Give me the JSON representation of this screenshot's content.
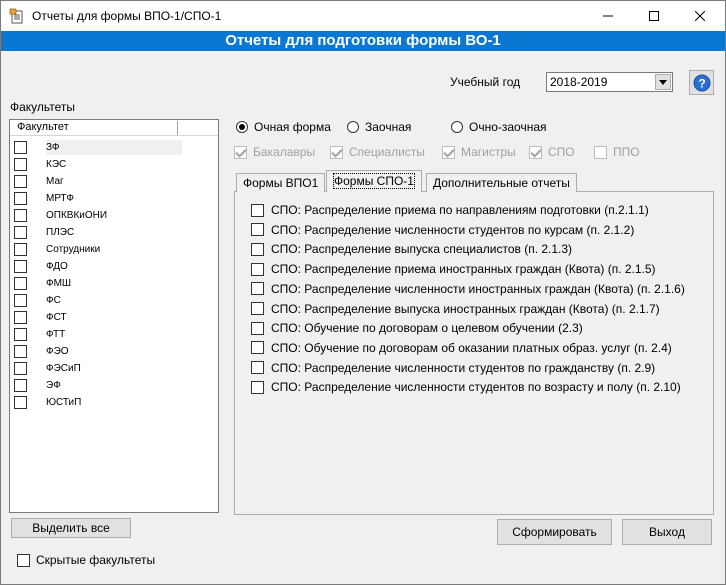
{
  "window": {
    "title": "Отчеты для формы ВПО-1/СПО-1",
    "controls": {
      "minimize": "—",
      "maximize": "☐",
      "close": "✕"
    }
  },
  "banner": {
    "title": "Отчеты для подготовки формы ВО-1"
  },
  "study_year": {
    "label": "Учебный год",
    "value": "2018-2019"
  },
  "help": {
    "label": "?"
  },
  "faculties": {
    "title": "Факультеты",
    "column_header": "Факультет",
    "items": [
      {
        "name": "ЗФ"
      },
      {
        "name": "КЭС"
      },
      {
        "name": "Маг"
      },
      {
        "name": "МРТФ"
      },
      {
        "name": "ОПКВКиОНИ"
      },
      {
        "name": "ПЛЭС"
      },
      {
        "name": "Сотрудники"
      },
      {
        "name": "ФДО"
      },
      {
        "name": "ФМШ"
      },
      {
        "name": "ФС"
      },
      {
        "name": "ФСТ"
      },
      {
        "name": "ФТТ"
      },
      {
        "name": "ФЭО"
      },
      {
        "name": "ФЭСиП"
      },
      {
        "name": "ЭФ"
      },
      {
        "name": "ЮСТиП"
      }
    ],
    "select_all": "Выделить все",
    "hidden_label": "Скрытые факультеты"
  },
  "study_forms": {
    "options": [
      "Очная форма",
      "Заочная",
      "Очно-заочная"
    ],
    "selected": "Очная форма"
  },
  "levels": [
    {
      "label": "Бакалавры",
      "checked": true
    },
    {
      "label": "Специалисты",
      "checked": true
    },
    {
      "label": "Магистры",
      "checked": true
    },
    {
      "label": "СПО",
      "checked": true
    },
    {
      "label": "ППО",
      "checked": false
    }
  ],
  "tabs": [
    {
      "label": "Формы ВПО1",
      "active": false
    },
    {
      "label": "Формы СПО-1",
      "active": true
    },
    {
      "label": "Дополнительные отчеты",
      "active": false
    }
  ],
  "reports": [
    "СПО: Распределение приема по направлениям подготовки  (п.2.1.1)",
    "СПО: Распределение численности студентов по курсам (п. 2.1.2)",
    "СПО: Распределение выпуска специалистов (п. 2.1.3)",
    "СПО: Распределение приема иностранных граждан (Квота)  (п. 2.1.5)",
    "СПО: Распределение численности иностранных граждан (Квота)  (п. 2.1.6)",
    "СПО: Распределение выпуска иностранных граждан (Квота)  (п. 2.1.7)",
    "СПО: Обучение по договорам о целевом обучении (2.3)",
    "СПО: Обучение по договорам об оказании платных образ. услуг (п. 2.4)",
    "СПО: Распределение численности студентов по гражданству (п. 2.9)",
    "СПО: Распределение численности студентов по возрасту и полу  (п. 2.10)"
  ],
  "actions": {
    "generate": "Сформировать",
    "exit": "Выход"
  },
  "colors": {
    "banner": "#0a78d2",
    "window_bg": "#f0f0f0"
  }
}
